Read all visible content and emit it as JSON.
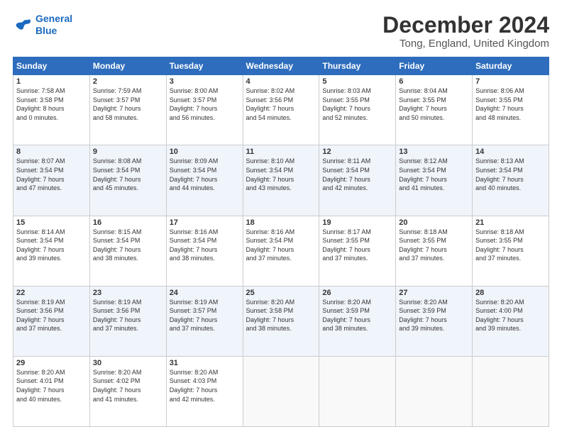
{
  "logo": {
    "line1": "General",
    "line2": "Blue"
  },
  "header": {
    "month": "December 2024",
    "location": "Tong, England, United Kingdom"
  },
  "weekdays": [
    "Sunday",
    "Monday",
    "Tuesday",
    "Wednesday",
    "Thursday",
    "Friday",
    "Saturday"
  ],
  "weeks": [
    [
      {
        "day": 1,
        "sunrise": "7:58 AM",
        "sunset": "3:58 PM",
        "daylight_hours": 8,
        "daylight_minutes": 0
      },
      {
        "day": 2,
        "sunrise": "7:59 AM",
        "sunset": "3:57 PM",
        "daylight_hours": 7,
        "daylight_minutes": 58
      },
      {
        "day": 3,
        "sunrise": "8:00 AM",
        "sunset": "3:57 PM",
        "daylight_hours": 7,
        "daylight_minutes": 56
      },
      {
        "day": 4,
        "sunrise": "8:02 AM",
        "sunset": "3:56 PM",
        "daylight_hours": 7,
        "daylight_minutes": 54
      },
      {
        "day": 5,
        "sunrise": "8:03 AM",
        "sunset": "3:55 PM",
        "daylight_hours": 7,
        "daylight_minutes": 52
      },
      {
        "day": 6,
        "sunrise": "8:04 AM",
        "sunset": "3:55 PM",
        "daylight_hours": 7,
        "daylight_minutes": 50
      },
      {
        "day": 7,
        "sunrise": "8:06 AM",
        "sunset": "3:55 PM",
        "daylight_hours": 7,
        "daylight_minutes": 48
      }
    ],
    [
      {
        "day": 8,
        "sunrise": "8:07 AM",
        "sunset": "3:54 PM",
        "daylight_hours": 7,
        "daylight_minutes": 47
      },
      {
        "day": 9,
        "sunrise": "8:08 AM",
        "sunset": "3:54 PM",
        "daylight_hours": 7,
        "daylight_minutes": 45
      },
      {
        "day": 10,
        "sunrise": "8:09 AM",
        "sunset": "3:54 PM",
        "daylight_hours": 7,
        "daylight_minutes": 44
      },
      {
        "day": 11,
        "sunrise": "8:10 AM",
        "sunset": "3:54 PM",
        "daylight_hours": 7,
        "daylight_minutes": 43
      },
      {
        "day": 12,
        "sunrise": "8:11 AM",
        "sunset": "3:54 PM",
        "daylight_hours": 7,
        "daylight_minutes": 42
      },
      {
        "day": 13,
        "sunrise": "8:12 AM",
        "sunset": "3:54 PM",
        "daylight_hours": 7,
        "daylight_minutes": 41
      },
      {
        "day": 14,
        "sunrise": "8:13 AM",
        "sunset": "3:54 PM",
        "daylight_hours": 7,
        "daylight_minutes": 40
      }
    ],
    [
      {
        "day": 15,
        "sunrise": "8:14 AM",
        "sunset": "3:54 PM",
        "daylight_hours": 7,
        "daylight_minutes": 39
      },
      {
        "day": 16,
        "sunrise": "8:15 AM",
        "sunset": "3:54 PM",
        "daylight_hours": 7,
        "daylight_minutes": 38
      },
      {
        "day": 17,
        "sunrise": "8:16 AM",
        "sunset": "3:54 PM",
        "daylight_hours": 7,
        "daylight_minutes": 38
      },
      {
        "day": 18,
        "sunrise": "8:16 AM",
        "sunset": "3:54 PM",
        "daylight_hours": 7,
        "daylight_minutes": 37
      },
      {
        "day": 19,
        "sunrise": "8:17 AM",
        "sunset": "3:55 PM",
        "daylight_hours": 7,
        "daylight_minutes": 37
      },
      {
        "day": 20,
        "sunrise": "8:18 AM",
        "sunset": "3:55 PM",
        "daylight_hours": 7,
        "daylight_minutes": 37
      },
      {
        "day": 21,
        "sunrise": "8:18 AM",
        "sunset": "3:55 PM",
        "daylight_hours": 7,
        "daylight_minutes": 37
      }
    ],
    [
      {
        "day": 22,
        "sunrise": "8:19 AM",
        "sunset": "3:56 PM",
        "daylight_hours": 7,
        "daylight_minutes": 37
      },
      {
        "day": 23,
        "sunrise": "8:19 AM",
        "sunset": "3:56 PM",
        "daylight_hours": 7,
        "daylight_minutes": 37
      },
      {
        "day": 24,
        "sunrise": "8:19 AM",
        "sunset": "3:57 PM",
        "daylight_hours": 7,
        "daylight_minutes": 37
      },
      {
        "day": 25,
        "sunrise": "8:20 AM",
        "sunset": "3:58 PM",
        "daylight_hours": 7,
        "daylight_minutes": 38
      },
      {
        "day": 26,
        "sunrise": "8:20 AM",
        "sunset": "3:59 PM",
        "daylight_hours": 7,
        "daylight_minutes": 38
      },
      {
        "day": 27,
        "sunrise": "8:20 AM",
        "sunset": "3:59 PM",
        "daylight_hours": 7,
        "daylight_minutes": 39
      },
      {
        "day": 28,
        "sunrise": "8:20 AM",
        "sunset": "4:00 PM",
        "daylight_hours": 7,
        "daylight_minutes": 39
      }
    ],
    [
      {
        "day": 29,
        "sunrise": "8:20 AM",
        "sunset": "4:01 PM",
        "daylight_hours": 7,
        "daylight_minutes": 40
      },
      {
        "day": 30,
        "sunrise": "8:20 AM",
        "sunset": "4:02 PM",
        "daylight_hours": 7,
        "daylight_minutes": 41
      },
      {
        "day": 31,
        "sunrise": "8:20 AM",
        "sunset": "4:03 PM",
        "daylight_hours": 7,
        "daylight_minutes": 42
      },
      null,
      null,
      null,
      null
    ]
  ]
}
